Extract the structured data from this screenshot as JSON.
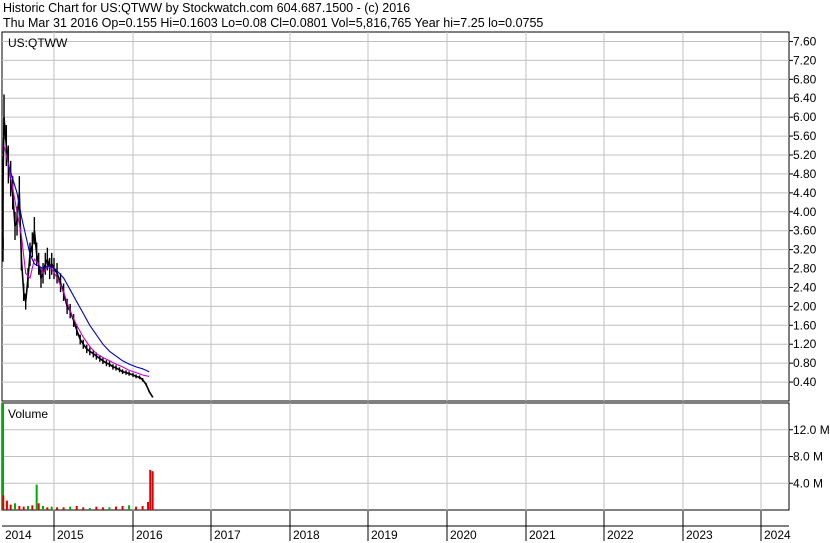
{
  "header": {
    "line1": "Historic Chart for US:QTWW by Stockwatch.com 604.687.1500 - (c) 2016",
    "line2": "Thu Mar 31 2016  Op=0.155  Hi=0.1603  Lo=0.08  Cl=0.0801  Vol=5,816,765  Year hi=7.25  lo=0.0755"
  },
  "price_panel": {
    "label": "US:QTWW"
  },
  "volume_panel": {
    "label": "Volume"
  },
  "chart_data": [
    {
      "type": "line",
      "title": "US:QTWW",
      "xlabel": "",
      "ylabel": "",
      "x_ticks": [
        "2014",
        "2015",
        "2016",
        "2017",
        "2018",
        "2019",
        "2020",
        "2021",
        "2022",
        "2023",
        "2024"
      ],
      "ylim": [
        0,
        7.8
      ],
      "y_ticks": [
        0.4,
        0.8,
        1.2,
        1.6,
        2.0,
        2.4,
        2.8,
        3.2,
        3.6,
        4.0,
        4.4,
        4.8,
        5.2,
        5.6,
        6.0,
        6.4,
        6.8,
        7.2,
        7.6
      ],
      "y_tick_labels": [
        "0.40",
        "0.80",
        "1.20",
        "1.60",
        "2.00",
        "2.40",
        "2.80",
        "3.20",
        "3.60",
        "4.00",
        "4.40",
        "4.80",
        "5.20",
        "5.60",
        "6.00",
        "6.40",
        "6.80",
        "7.20",
        "7.60"
      ],
      "grid": true,
      "series": [
        {
          "color": "#000000",
          "x": [
            "2013-12-15",
            "2014-01-01",
            "2014-01-15",
            "2014-02-01",
            "2014-02-15",
            "2014-03-01",
            "2014-03-15",
            "2014-04-01",
            "2014-04-15",
            "2014-05-01",
            "2014-05-15",
            "2014-06-01",
            "2014-06-15",
            "2014-07-01",
            "2014-07-15",
            "2014-08-01",
            "2014-08-15",
            "2014-09-01",
            "2014-09-15",
            "2014-10-01",
            "2014-10-15",
            "2014-11-01",
            "2014-11-15",
            "2014-12-01",
            "2014-12-15",
            "2015-01-01",
            "2015-01-15",
            "2015-02-01",
            "2015-02-15",
            "2015-03-01",
            "2015-03-15",
            "2015-04-01",
            "2015-04-15",
            "2015-05-01",
            "2015-05-15",
            "2015-06-01",
            "2015-06-15",
            "2015-07-01",
            "2015-07-15",
            "2015-08-01",
            "2015-08-15",
            "2015-09-01",
            "2015-09-15",
            "2015-10-01",
            "2015-10-15",
            "2015-11-01",
            "2015-11-15",
            "2015-12-01",
            "2015-12-15",
            "2016-01-01",
            "2016-01-15",
            "2016-02-01",
            "2016-02-15",
            "2016-03-01",
            "2016-03-15",
            "2016-03-31"
          ],
          "values": [
            3.2,
            4.6,
            6.0,
            5.4,
            5.0,
            4.7,
            4.4,
            3.7,
            3.8,
            4.4,
            3.0,
            2.3,
            2.1,
            2.6,
            3.1,
            3.3,
            3.6,
            3.1,
            2.9,
            2.6,
            2.7,
            2.9,
            3.0,
            2.8,
            2.9,
            2.8,
            2.7,
            2.5,
            2.3,
            2.0,
            1.9,
            1.7,
            1.5,
            1.3,
            1.2,
            1.1,
            1.05,
            1.0,
            0.95,
            0.9,
            0.85,
            0.8,
            0.78,
            0.72,
            0.7,
            0.66,
            0.62,
            0.6,
            0.58,
            0.55,
            0.52,
            0.5,
            0.45,
            0.35,
            0.2,
            0.08
          ]
        },
        {
          "color": "#cc00cc",
          "x": [
            "2014-01-15",
            "2014-02-15",
            "2014-03-15",
            "2014-04-15",
            "2014-05-15",
            "2014-06-15",
            "2014-07-15",
            "2014-08-15",
            "2014-09-15",
            "2014-10-15",
            "2014-11-15",
            "2014-12-15",
            "2015-01-15",
            "2015-02-15",
            "2015-03-15",
            "2015-04-15",
            "2015-05-15",
            "2015-06-15",
            "2015-07-15",
            "2015-08-15",
            "2015-09-15",
            "2015-10-15",
            "2015-11-15",
            "2015-12-15",
            "2016-01-15",
            "2016-02-15",
            "2016-03-15"
          ],
          "values": [
            5.4,
            5.0,
            4.5,
            4.0,
            3.5,
            2.7,
            2.6,
            3.0,
            2.9,
            2.7,
            2.85,
            2.8,
            2.6,
            2.3,
            1.9,
            1.6,
            1.35,
            1.15,
            1.0,
            0.92,
            0.85,
            0.78,
            0.72,
            0.65,
            0.6,
            0.55,
            0.52
          ]
        },
        {
          "color": "#0000cc",
          "x": [
            "2014-02-15",
            "2014-03-15",
            "2014-04-15",
            "2014-05-15",
            "2014-06-15",
            "2014-07-15",
            "2014-08-15",
            "2014-09-15",
            "2014-10-15",
            "2014-11-15",
            "2014-12-15",
            "2015-01-15",
            "2015-02-15",
            "2015-03-15",
            "2015-04-15",
            "2015-05-15",
            "2015-06-15",
            "2015-07-15",
            "2015-08-15",
            "2015-09-15",
            "2015-10-15",
            "2015-11-15",
            "2015-12-15",
            "2016-01-15",
            "2016-02-15",
            "2016-03-15"
          ],
          "values": [
            5.0,
            4.7,
            4.4,
            3.9,
            3.5,
            3.1,
            2.9,
            2.85,
            2.8,
            2.85,
            2.85,
            2.75,
            2.6,
            2.35,
            2.1,
            1.85,
            1.6,
            1.4,
            1.2,
            1.05,
            0.95,
            0.85,
            0.78,
            0.72,
            0.68,
            0.62
          ]
        }
      ]
    },
    {
      "type": "bar",
      "title": "Volume",
      "xlabel": "",
      "ylabel": "",
      "ylim": [
        0,
        16
      ],
      "y_ticks": [
        4,
        8,
        12
      ],
      "y_tick_labels": [
        "4.0 M",
        "8.0 M",
        "12.0 M"
      ],
      "grid": true,
      "x": [
        "2013-12-20",
        "2014-01-10",
        "2014-02-05",
        "2014-03-01",
        "2014-04-01",
        "2014-05-01",
        "2014-06-01",
        "2014-07-01",
        "2014-08-01",
        "2014-09-01",
        "2014-09-15",
        "2014-10-15",
        "2014-11-15",
        "2014-12-15",
        "2015-01-15",
        "2015-02-15",
        "2015-03-15",
        "2015-04-15",
        "2015-05-15",
        "2015-06-15",
        "2015-07-15",
        "2015-08-15",
        "2015-09-15",
        "2015-10-15",
        "2015-11-15",
        "2015-12-15",
        "2016-01-15",
        "2016-02-15",
        "2016-03-10",
        "2016-03-20",
        "2016-03-31"
      ],
      "values": [
        16.0,
        2.2,
        1.4,
        0.8,
        1.0,
        0.6,
        0.5,
        0.6,
        0.7,
        3.8,
        1.0,
        0.6,
        0.4,
        0.5,
        0.4,
        0.4,
        0.5,
        0.6,
        0.4,
        0.3,
        0.5,
        0.4,
        0.4,
        0.5,
        0.6,
        0.7,
        0.5,
        0.6,
        1.2,
        6.0,
        5.8
      ],
      "colors": [
        "#00aa00",
        "#dd0000",
        "#dd0000",
        "#dd0000",
        "#00aa00",
        "#dd0000",
        "#dd0000",
        "#00aa00",
        "#dd0000",
        "#00aa00",
        "#dd0000",
        "#00aa00",
        "#dd0000",
        "#00aa00",
        "#dd0000",
        "#dd0000",
        "#00aa00",
        "#dd0000",
        "#dd0000",
        "#00aa00",
        "#dd0000",
        "#dd0000",
        "#00aa00",
        "#dd0000",
        "#dd0000",
        "#00aa00",
        "#dd0000",
        "#dd0000",
        "#dd0000",
        "#dd0000",
        "#dd0000"
      ]
    }
  ]
}
